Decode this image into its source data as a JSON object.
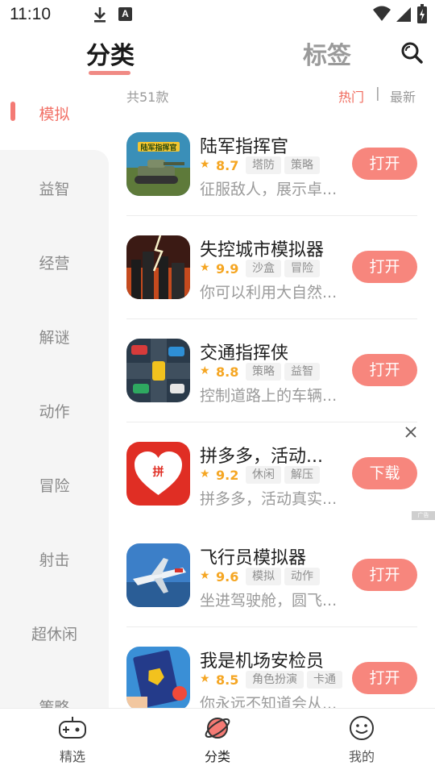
{
  "status_bar": {
    "time": "11:10",
    "notif_letter": "A"
  },
  "top_tabs": {
    "category": "分类",
    "tags": "标签"
  },
  "sidebar": {
    "items": [
      {
        "label": "模拟"
      },
      {
        "label": "益智"
      },
      {
        "label": "经营"
      },
      {
        "label": "解谜"
      },
      {
        "label": "动作"
      },
      {
        "label": "冒险"
      },
      {
        "label": "射击"
      },
      {
        "label": "超休闲"
      },
      {
        "label": "策略"
      }
    ],
    "active_index": 0
  },
  "list_header": {
    "count": "共51款",
    "sort_hot": "热门",
    "separator": "|",
    "sort_new": "最新"
  },
  "apps": [
    {
      "name": "陆军指挥官",
      "rating": "8.7",
      "tags": [
        "塔防",
        "策略"
      ],
      "desc": "征服敌人，展示卓...",
      "button": "打开",
      "icon_text": "陆军指挥官"
    },
    {
      "name": "失控城市模拟器",
      "rating": "9.9",
      "tags": [
        "沙盒",
        "冒险"
      ],
      "desc": "你可以利用大自然...",
      "button": "打开"
    },
    {
      "name": "交通指挥侠",
      "rating": "8.8",
      "tags": [
        "策略",
        "益智"
      ],
      "desc": "控制道路上的车辆...",
      "button": "打开"
    },
    {
      "name": "拼多多，活动...",
      "rating": "9.2",
      "tags": [
        "休闲",
        "解压"
      ],
      "desc": "拼多多，活动真实...",
      "button": "下载",
      "icon_text": "拼"
    },
    {
      "name": "飞行员模拟器",
      "rating": "9.6",
      "tags": [
        "模拟",
        "动作"
      ],
      "desc": "坐进驾驶舱，圆飞...",
      "button": "打开"
    },
    {
      "name": "我是机场安检员",
      "rating": "8.5",
      "tags": [
        "角色扮演",
        "卡通"
      ],
      "desc": "你永远不知道会从...",
      "button": "打开"
    }
  ],
  "ad": {
    "badge": "广告"
  },
  "bottom_nav": {
    "items": [
      {
        "label": "精选",
        "icon": "gamepad-icon"
      },
      {
        "label": "分类",
        "icon": "planet-icon"
      },
      {
        "label": "我的",
        "icon": "smiley-icon"
      }
    ],
    "active_index": 1
  },
  "colors": {
    "accent": "#f7867d",
    "active_text": "#f27066",
    "rating": "#f5a623"
  }
}
